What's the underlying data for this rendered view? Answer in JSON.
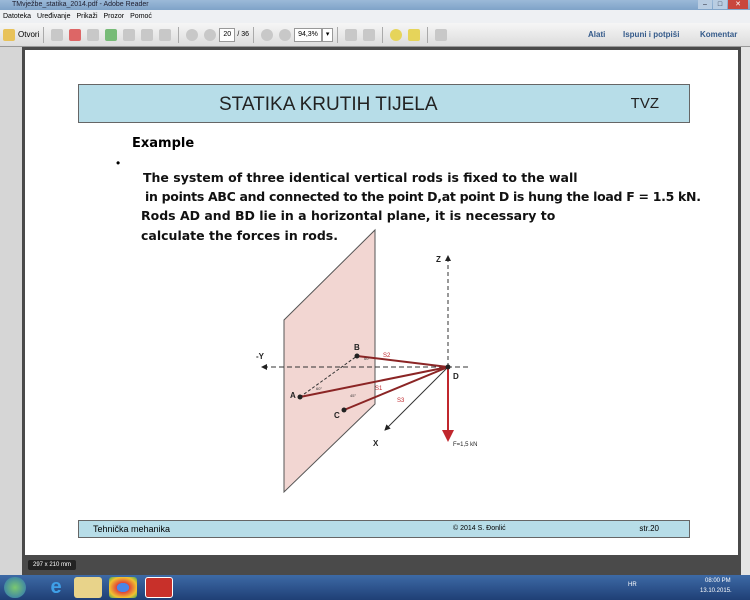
{
  "window": {
    "title": "TMvježbe_statika_2014.pdf - Adobe Reader"
  },
  "menu": [
    "Datoteka",
    "Uređivanje",
    "Prikaži",
    "Prozor",
    "Pomoć"
  ],
  "toolbar": {
    "open": "Otvori",
    "page": "20",
    "pages": "/ 36",
    "zoom": "94,3%",
    "tools": "Alati",
    "sign": "Ispuni i potpiši",
    "comment": "Komentar"
  },
  "slide": {
    "title": "STATIKA KRUTIH TIJELA",
    "org": "TVZ",
    "heading": "Example",
    "bullet": "•",
    "lines": [
      "The system of three identical vertical rods is fixed to the wall",
      "in points ABC and connected to the point D,at point D is hung the load F = 1.5 kN.",
      "Rods AD and BD lie in a horizontal plane, it is necessary to",
      "calculate the forces in rods."
    ],
    "diagram": {
      "z": "Z",
      "y": "-Y",
      "x": "X",
      "A": "A",
      "B": "B",
      "C": "C",
      "D": "D",
      "s1": "S1",
      "s2": "S2",
      "s3": "S3",
      "F": "F=1,5 kN",
      "angA": "60°",
      "angB": "60°",
      "angC": "45°"
    },
    "footer_left": "Tehnička mehanika",
    "footer_center": "© 2014 S. Đonlić",
    "footer_right": "str.20"
  },
  "tooltip": "297 x 210 mm",
  "tray": {
    "lang": "HR",
    "time": "08:00 PM",
    "date": "13.10.2015."
  },
  "colors": {
    "header": "#b7dde8",
    "wall": "#f2d6d2",
    "rod": "#8b2525"
  }
}
